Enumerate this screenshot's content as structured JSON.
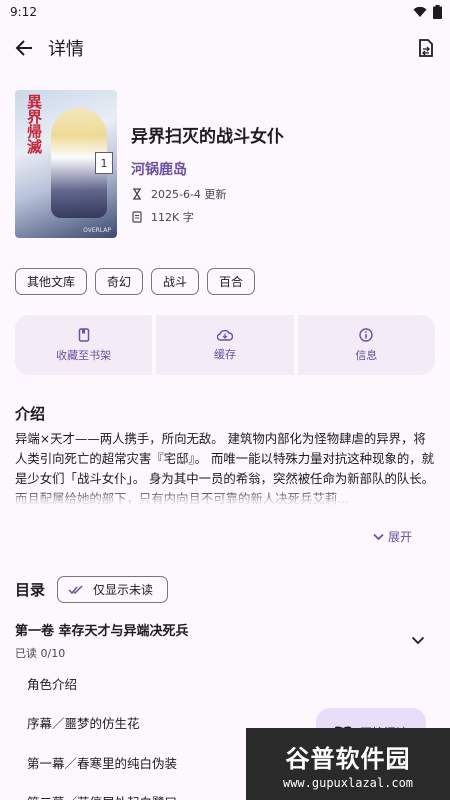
{
  "status_bar": {
    "time": "9:12"
  },
  "app_bar": {
    "title": "详情"
  },
  "book": {
    "cover_title": "異界帰滅",
    "cover_volume": "1",
    "cover_publisher": "OVERLAP",
    "title": "异界扫灭的战斗女仆",
    "author": "河锅鹿岛",
    "updated": "2025-6-4 更新",
    "word_count": "112K 字"
  },
  "tags": [
    "其他文库",
    "奇幻",
    "战斗",
    "百合"
  ],
  "actions": {
    "bookshelf": "收藏至书架",
    "cache": "缓存",
    "info": "信息"
  },
  "intro": {
    "heading": "介绍",
    "text": "异端×天才——两人携手，所向无敌。 建筑物内部化为怪物肆虐的异界，将人类引向死亡的超常灾害『宅邸』。 而唯一能以特殊力量对抗这种现象的，就是少女们「战斗女仆」。 身为其中一员的希翁，突然被任命为新部队的队长。 而且配属给她的部下，只有内向且不可靠的新人决死兵艾莉...",
    "expand_label": "展开"
  },
  "toc": {
    "heading": "目录",
    "filter_label": "仅显示未读",
    "volume_title": "第一卷 幸存天才与异端决死兵",
    "volume_progress": "已读 0/10",
    "chapters": [
      "角色介绍",
      "序幕／噩梦的仿生花",
      "第一幕／春寒里的纯白伪装",
      "第二幕／花停居处起白鹭曰"
    ]
  },
  "fab": {
    "label": "开始阅读"
  },
  "watermark": {
    "main": "谷普软件园",
    "sub": "www.gupuxlazal.com"
  },
  "colors": {
    "accent": "#6b4ea6",
    "card_bg": "#f3ecf6",
    "fab_bg": "#e8def8",
    "page_bg": "#fdf8fd"
  }
}
